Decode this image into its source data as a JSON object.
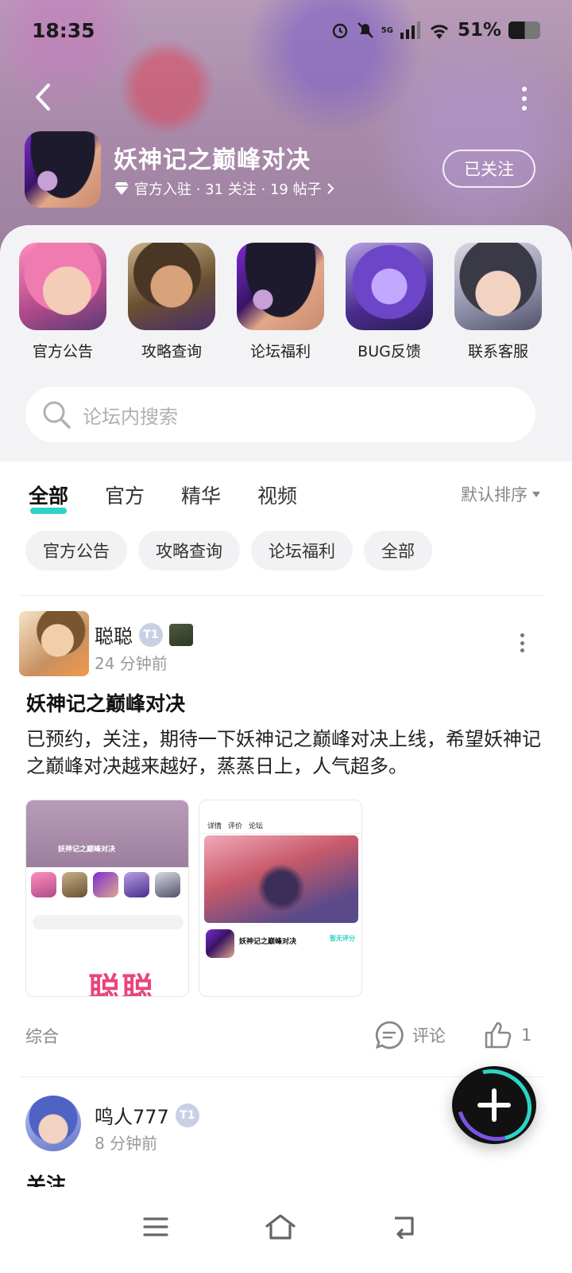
{
  "status_bar": {
    "time": "18:35",
    "network": "5G",
    "battery": "51%"
  },
  "forum": {
    "title": "妖神记之巅峰对决",
    "meta": "官方入驻 · 31 关注 · 19 帖子",
    "follow_label": "已关注"
  },
  "shortcuts": [
    {
      "label": "官方公告"
    },
    {
      "label": "攻略查询"
    },
    {
      "label": "论坛福利"
    },
    {
      "label": "BUG反馈"
    },
    {
      "label": "联系客服"
    }
  ],
  "search": {
    "placeholder": "论坛内搜索"
  },
  "tabs": [
    {
      "label": "全部",
      "active": true
    },
    {
      "label": "官方"
    },
    {
      "label": "精华"
    },
    {
      "label": "视频"
    }
  ],
  "sort": {
    "label": "默认排序"
  },
  "chips": [
    {
      "label": "官方公告"
    },
    {
      "label": "攻略查询"
    },
    {
      "label": "论坛福利"
    },
    {
      "label": "全部"
    }
  ],
  "posts": [
    {
      "author": "聪聪",
      "time": "24 分钟前",
      "title": "妖神记之巅峰对决",
      "body": "已预约，关注，期待一下妖神记之巅峰对决上线，希望妖神记之巅峰对决越来越好，蒸蒸日上，人气超多。",
      "images": [
        {
          "title": "妖神记之巅峰对决",
          "stamp": "聪聪"
        },
        {
          "tabs": [
            "详情",
            "评价",
            "论坛"
          ],
          "game_name": "妖神记之巅峰对决",
          "tag": "暂无评分"
        }
      ],
      "category": "综合",
      "comment_label": "评论",
      "like_count": "1"
    },
    {
      "author": "鸣人777",
      "time": "8 分钟前",
      "title": "关注"
    }
  ],
  "colors": {
    "accent": "#2cd4c5",
    "fab_purple": "#7b54e6",
    "header_tint": "#a98aaa"
  },
  "nav": {
    "icons": [
      "menu-icon",
      "home-icon",
      "back-icon"
    ]
  }
}
